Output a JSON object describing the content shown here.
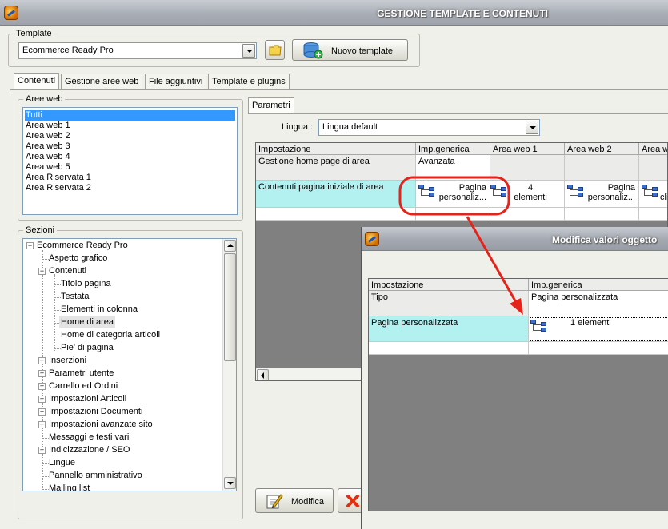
{
  "window": {
    "title": "GESTIONE TEMPLATE E CONTENUTI",
    "icon": "app-icon"
  },
  "template_group": {
    "legend": "Template",
    "selected": "Ecommerce Ready Pro",
    "open_icon": "folder-icon",
    "new_button_label": "Nuovo template",
    "new_button_icon": "add-database-icon"
  },
  "tabs": [
    {
      "label": "Contenuti",
      "active": true
    },
    {
      "label": "Gestione aree web"
    },
    {
      "label": "File aggiuntivi"
    },
    {
      "label": "Template e plugins"
    }
  ],
  "aree_web": {
    "legend": "Aree web",
    "items": [
      "Tutti",
      "Area web 1",
      "Area web 2",
      "Area web 3",
      "Area web 4",
      "Area web 5",
      "Area Riservata 1",
      "Area Riservata 2"
    ],
    "selected_index": 0
  },
  "sezioni": {
    "legend": "Sezioni",
    "root": "Ecommerce Ready Pro",
    "items": [
      "Aspetto grafico",
      "Contenuti",
      "Titolo pagina",
      "Testata",
      "Elementi in colonna",
      "Home di area",
      "Home di categoria articoli",
      "Pie' di pagina",
      "Inserzioni",
      "Parametri utente",
      "Carrello ed Ordini",
      "Impostazioni Articoli",
      "Impostazioni Documenti",
      "Impostazioni avanzate sito",
      "Messaggi e testi vari",
      "Indicizzazione / SEO",
      "Lingue",
      "Pannello amministrativo",
      "Mailing list"
    ],
    "highlighted": "Home di area"
  },
  "parametri": {
    "tab_label": "Parametri",
    "lingua_label": "Lingua :",
    "lingua_value": "Lingua default",
    "columns": [
      "Impostazione",
      "Imp.generica",
      "Area web 1",
      "Area web 2",
      "Area w"
    ],
    "rows": [
      {
        "name": "Gestione home page di area",
        "cells": [
          "Avanzata",
          "",
          "",
          ""
        ]
      },
      {
        "name": "Contenuti pagina iniziale di area",
        "cells": [
          "Pagina personaliz...",
          "4 elementi",
          "Pagina personaliz...",
          "cli"
        ]
      }
    ]
  },
  "buttons": {
    "modifica": "Modifica",
    "modifica_icon": "edit-icon",
    "delete_icon": "delete-icon"
  },
  "dialog": {
    "title": "Modifica valori oggetto",
    "columns": [
      "Impostazione",
      "Imp.generica"
    ],
    "rows": [
      {
        "name": "Tipo",
        "value": "Pagina personalizzata"
      },
      {
        "name": "Pagina personalizzata",
        "value": "1 elementi"
      }
    ]
  },
  "annotation": {
    "color": "#e5231b"
  }
}
